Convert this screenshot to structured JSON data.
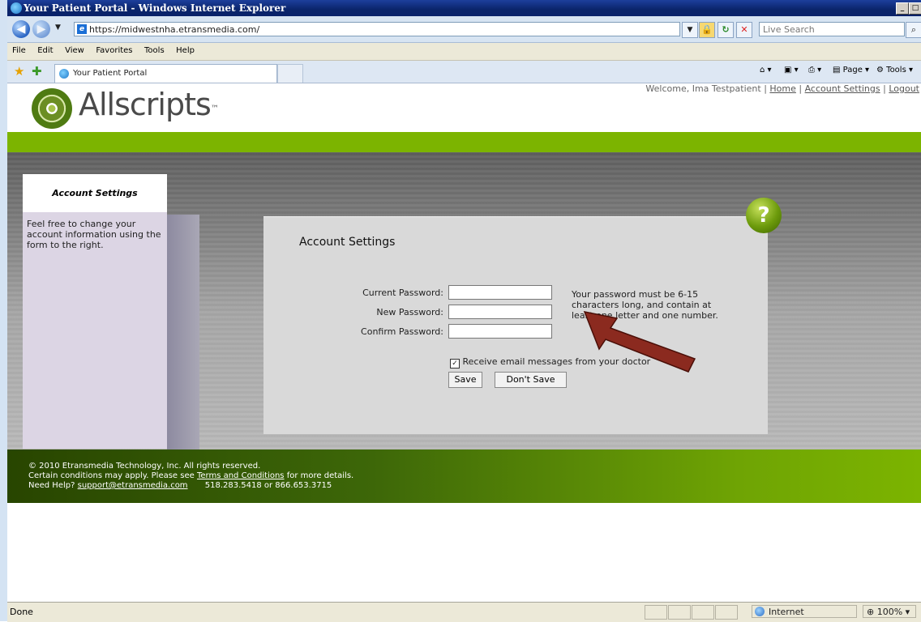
{
  "window": {
    "title": "Your Patient Portal - Windows Internet Explorer"
  },
  "address": {
    "url": "https://midwestnha.etransmedia.com/",
    "search_placeholder": "Live Search"
  },
  "menu": [
    "File",
    "Edit",
    "View",
    "Favorites",
    "Tools",
    "Help"
  ],
  "tab": {
    "label": "Your Patient Portal"
  },
  "toolbar": {
    "page_label": "Page",
    "tools_label": "Tools"
  },
  "header": {
    "welcome": "Welcome, Ima Testpatient |",
    "home": "Home",
    "account_settings": "Account Settings",
    "logout": "Logout",
    "logo_text": "Allscripts",
    "logo_tm": "™"
  },
  "sidebar": {
    "title": "Account Settings",
    "description": "Feel free to change your account information using the form to the right."
  },
  "panel": {
    "title": "Account Settings",
    "current_password_label": "Current Password:",
    "new_password_label": "New Password:",
    "confirm_password_label": "Confirm Password:",
    "password_hint": "Your password must be 6-15 characters long, and contain at least one letter and one number.",
    "email_label": "Receive email messages from your doctor",
    "email_checked": true,
    "save_label": "Save",
    "dont_save_label": "Don't Save",
    "help_glyph": "?"
  },
  "footer": {
    "copyright": "© 2010 Etransmedia Technology, Inc. All rights reserved.",
    "terms_prefix": "Certain conditions may apply. Please see",
    "terms_link": "Terms and Conditions",
    "terms_suffix": "for more details.",
    "help_prefix": "Need Help?",
    "support_email": "support@etransmedia.com",
    "phones": "518.283.5418 or 866.653.3715"
  },
  "status": {
    "text": "Done",
    "zone": "Internet",
    "zoom": "100%"
  },
  "colors": {
    "brand_green": "#7cb400",
    "titlebar": "#0a246a",
    "arrow": "#8b2a1f"
  }
}
